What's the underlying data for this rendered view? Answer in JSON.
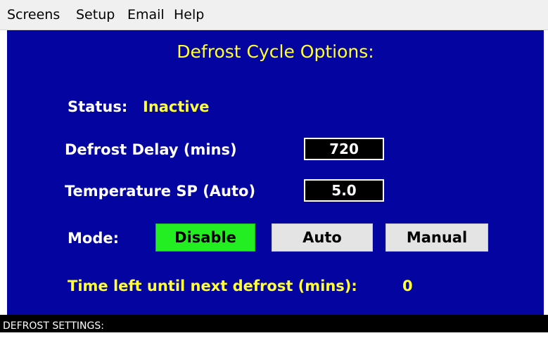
{
  "menu": {
    "items": [
      {
        "label": "Screens"
      },
      {
        "label": "Setup"
      },
      {
        "label": "Email"
      },
      {
        "label": "Help"
      }
    ]
  },
  "panel": {
    "title": "Defrost Cycle Options:",
    "status": {
      "label": "Status:",
      "value": "Inactive"
    },
    "defrost_delay": {
      "label": "Defrost Delay (mins)",
      "value": "720"
    },
    "temperature_sp": {
      "label": "Temperature SP (Auto)",
      "value": "5.0"
    },
    "mode": {
      "label": "Mode:",
      "options": [
        "Disable",
        "Auto",
        "Manual"
      ],
      "selected": "Disable"
    },
    "time_left": {
      "label": "Time left until next defrost (mins):",
      "value": "0"
    }
  },
  "statusbar": {
    "text": "DEFROST SETTINGS:"
  },
  "colors": {
    "panel_background": "#0404a0",
    "title_text": "#ffff33",
    "selected_mode": "#22ee22",
    "unselected_mode": "#e4e4e4"
  }
}
